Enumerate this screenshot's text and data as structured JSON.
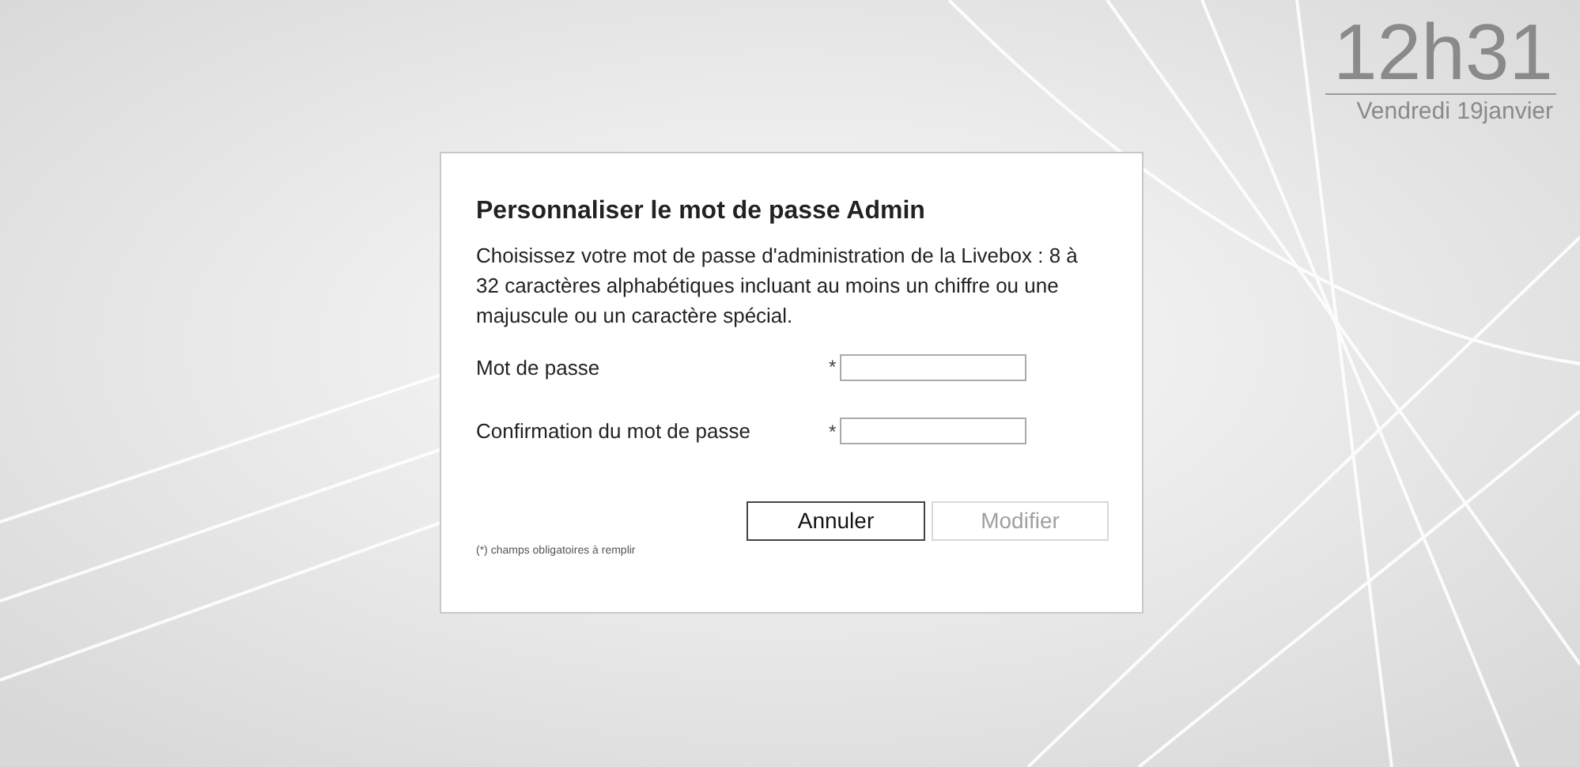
{
  "clock": {
    "time": "12h31",
    "date": "Vendredi 19janvier"
  },
  "dialog": {
    "title": "Personnaliser le mot de passe Admin",
    "description": "Choisissez votre mot de passe d'administration de la Livebox : 8 à 32 caractères alphabétiques incluant au moins un chiffre ou une majuscule ou un caractère spécial.",
    "fields": [
      {
        "label": "Mot de passe",
        "required_mark": "*"
      },
      {
        "label": "Confirmation du mot de passe",
        "required_mark": "*"
      }
    ],
    "buttons": [
      {
        "label": "Annuler",
        "disabled": false
      },
      {
        "label": "Modifier",
        "disabled": true
      }
    ],
    "footnote": "(*) champs obligatoires à remplir"
  }
}
